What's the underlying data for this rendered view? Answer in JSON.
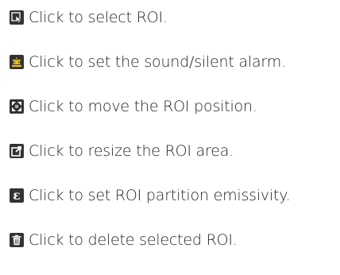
{
  "help_items": [
    {
      "icon": "select-roi-icon",
      "label": "Click to select ROI."
    },
    {
      "icon": "alarm-icon",
      "label": "Click to set the sound/silent alarm."
    },
    {
      "icon": "move-icon",
      "label": "Click to move the ROI position."
    },
    {
      "icon": "resize-icon",
      "label": "Click to resize the ROI area."
    },
    {
      "icon": "emissivity-icon",
      "label": "Click to set ROI partition emissivity.",
      "glyph": "ε"
    },
    {
      "icon": "delete-icon",
      "label": "Click to delete selected ROI."
    }
  ],
  "colors": {
    "icon_background": "#333333",
    "icon_accent": "#f0c419",
    "text": "#232323"
  }
}
